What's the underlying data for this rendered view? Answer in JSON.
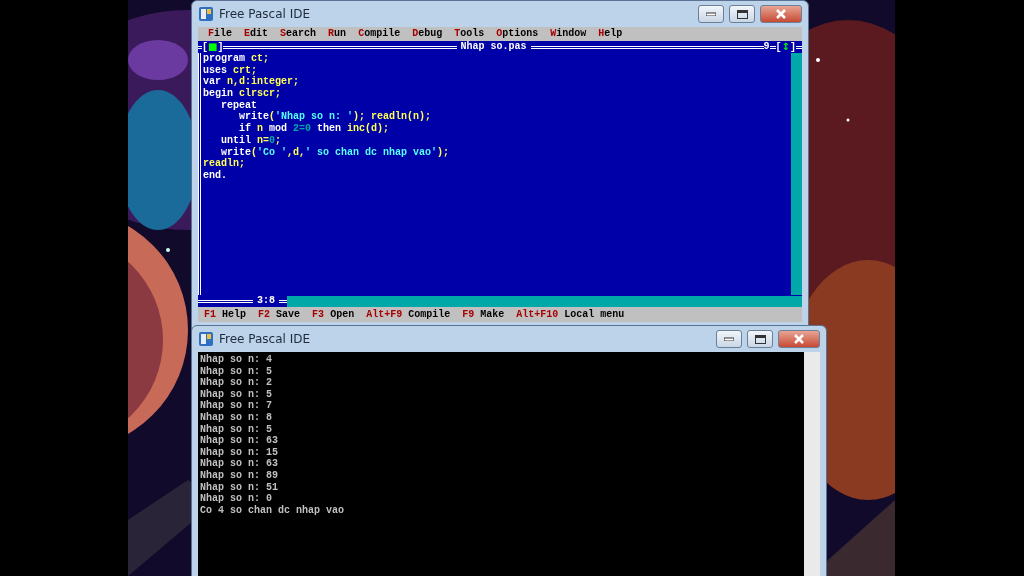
{
  "ide_window": {
    "title": "Free Pascal IDE",
    "menu": [
      {
        "hotkey": "F",
        "rest": "ile"
      },
      {
        "hotkey": "E",
        "rest": "dit"
      },
      {
        "hotkey": "S",
        "rest": "earch"
      },
      {
        "hotkey": "R",
        "rest": "un"
      },
      {
        "hotkey": "C",
        "rest": "ompile"
      },
      {
        "hotkey": "D",
        "rest": "ebug"
      },
      {
        "hotkey": "T",
        "rest": "ools"
      },
      {
        "hotkey": "O",
        "rest": "ptions"
      },
      {
        "hotkey": "W",
        "rest": "indow"
      },
      {
        "hotkey": "H",
        "rest": "elp"
      }
    ],
    "editor": {
      "close_box": "[■]",
      "title": "Nhap so.pas",
      "window_number": "9",
      "zoom_box": "[↕]",
      "cursor_position": "3:8",
      "lines": [
        [
          {
            "kind": "keyword",
            "text": "program "
          },
          {
            "kind": "ident",
            "text": "ct;"
          }
        ],
        [
          {
            "kind": "keyword",
            "text": "uses "
          },
          {
            "kind": "ident",
            "text": "crt;"
          }
        ],
        [
          {
            "kind": "keyword",
            "text": "var "
          },
          {
            "kind": "ident",
            "text": "n,d:integer;"
          }
        ],
        [
          {
            "kind": "keyword",
            "text": "begin "
          },
          {
            "kind": "ident",
            "text": "clrscr;"
          }
        ],
        [
          {
            "kind": "keyword",
            "text": "   repeat"
          }
        ],
        [
          {
            "kind": "keyword",
            "text": "      write"
          },
          {
            "kind": "ident",
            "text": "("
          },
          {
            "kind": "string",
            "text": "'Nhap so n: '"
          },
          {
            "kind": "ident",
            "text": "); readln(n);"
          }
        ],
        [
          {
            "kind": "keyword",
            "text": "      if "
          },
          {
            "kind": "ident",
            "text": "n "
          },
          {
            "kind": "keyword",
            "text": "mod "
          },
          {
            "kind": "number",
            "text": "2=0"
          },
          {
            "kind": "keyword",
            "text": " then "
          },
          {
            "kind": "ident",
            "text": "inc(d);"
          }
        ],
        [
          {
            "kind": "keyword",
            "text": "   until "
          },
          {
            "kind": "ident",
            "text": "n="
          },
          {
            "kind": "number",
            "text": "0"
          },
          {
            "kind": "ident",
            "text": ";"
          }
        ],
        [
          {
            "kind": "keyword",
            "text": "   write"
          },
          {
            "kind": "ident",
            "text": "("
          },
          {
            "kind": "string",
            "text": "'Co '"
          },
          {
            "kind": "ident",
            "text": ",d,"
          },
          {
            "kind": "string",
            "text": "' so chan dc nhap vao'"
          },
          {
            "kind": "ident",
            "text": ");"
          }
        ],
        [
          {
            "kind": "ident",
            "text": "readln;"
          }
        ],
        [
          {
            "kind": "keyword",
            "text": "end."
          }
        ]
      ]
    },
    "status_bar": [
      {
        "key": "F1",
        "label": "Help"
      },
      {
        "key": "F2",
        "label": "Save"
      },
      {
        "key": "F3",
        "label": "Open"
      },
      {
        "key": "Alt+F9",
        "label": "Compile"
      },
      {
        "key": "F9",
        "label": "Make"
      },
      {
        "key": "Alt+F10",
        "label": "Local menu"
      }
    ]
  },
  "console_window": {
    "title": "Free Pascal IDE",
    "lines": [
      "Nhap so n: 4",
      "Nhap so n: 5",
      "Nhap so n: 2",
      "Nhap so n: 5",
      "Nhap so n: 7",
      "Nhap so n: 8",
      "Nhap so n: 5",
      "Nhap so n: 63",
      "Nhap so n: 15",
      "Nhap so n: 63",
      "Nhap so n: 89",
      "Nhap so n: 51",
      "Nhap so n: 0",
      "Co 4 so chan dc nhap vao"
    ]
  }
}
